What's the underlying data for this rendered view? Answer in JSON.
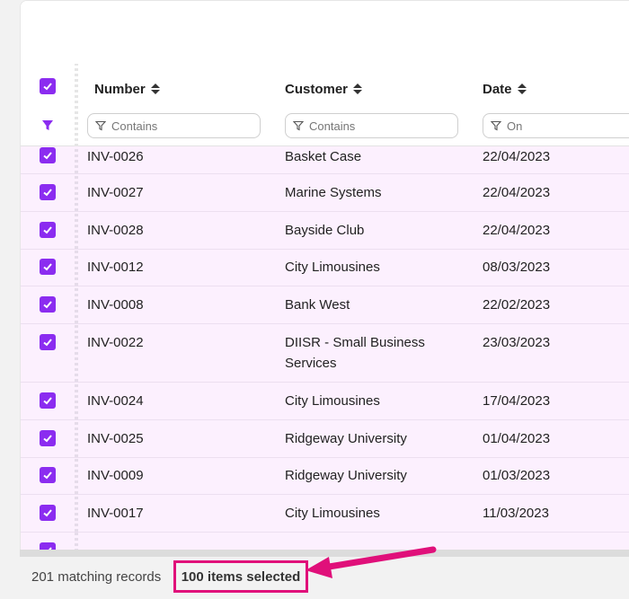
{
  "table": {
    "columns": [
      {
        "label": "Number",
        "filter_placeholder": "Contains"
      },
      {
        "label": "Customer",
        "filter_placeholder": "Contains"
      },
      {
        "label": "Date",
        "filter_placeholder": "On"
      }
    ],
    "rows": [
      {
        "number": "INV-0026",
        "customer": "Basket Case",
        "date": "22/04/2023"
      },
      {
        "number": "INV-0027",
        "customer": "Marine Systems",
        "date": "22/04/2023"
      },
      {
        "number": "INV-0028",
        "customer": "Bayside Club",
        "date": "22/04/2023"
      },
      {
        "number": "INV-0012",
        "customer": "City Limousines",
        "date": "08/03/2023"
      },
      {
        "number": "INV-0008",
        "customer": "Bank West",
        "date": "22/02/2023"
      },
      {
        "number": "INV-0022",
        "customer": "DIISR - Small Business Services",
        "date": "23/03/2023"
      },
      {
        "number": "INV-0024",
        "customer": "City Limousines",
        "date": "17/04/2023"
      },
      {
        "number": "INV-0025",
        "customer": "Ridgeway University",
        "date": "01/04/2023"
      },
      {
        "number": "INV-0009",
        "customer": "Ridgeway University",
        "date": "01/03/2023"
      },
      {
        "number": "INV-0017",
        "customer": "City Limousines",
        "date": "11/03/2023"
      }
    ]
  },
  "footer": {
    "matching_records": "201 matching records",
    "items_selected": "100 items selected"
  },
  "colors": {
    "accent": "#8b2cf0",
    "row_selected_bg": "#fcf0fe",
    "highlight": "#e0107a"
  }
}
